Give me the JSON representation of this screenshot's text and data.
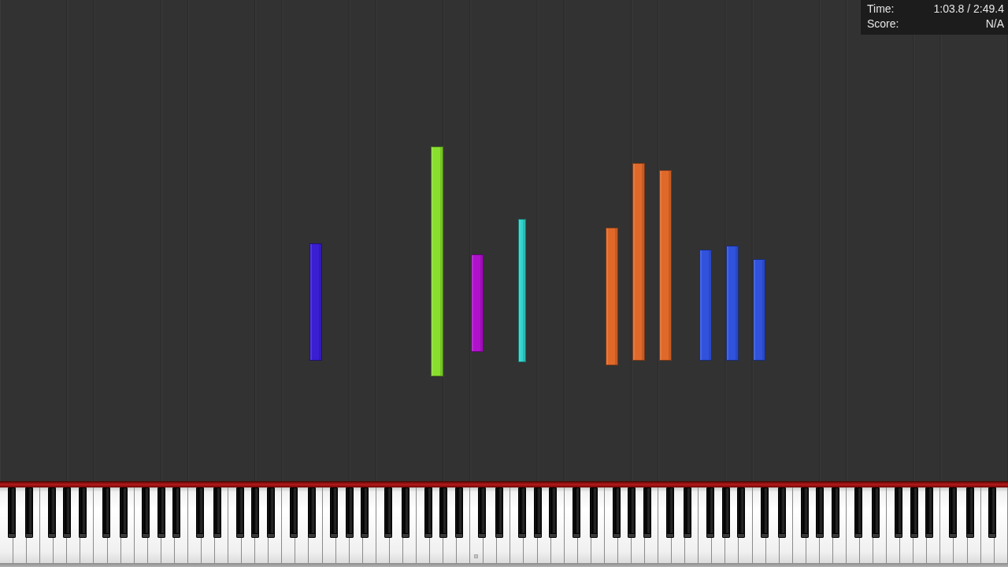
{
  "info_panel": {
    "rows": [
      {
        "label": "Time:",
        "value": "1:03.8 / 2:49.4"
      },
      {
        "label": "Score:",
        "value": "N/A"
      }
    ]
  },
  "notes": [
    {
      "color": "#3a1ed2"
    },
    {
      "color": "#88e02c"
    },
    {
      "color": "#b012cc"
    },
    {
      "color": "#30d4cc"
    },
    {
      "color": "#e0692a"
    },
    {
      "color": "#e0692a"
    },
    {
      "color": "#e0692a"
    },
    {
      "color": "#3052dc"
    },
    {
      "color": "#3052dc"
    },
    {
      "color": "#3052dc"
    }
  ]
}
